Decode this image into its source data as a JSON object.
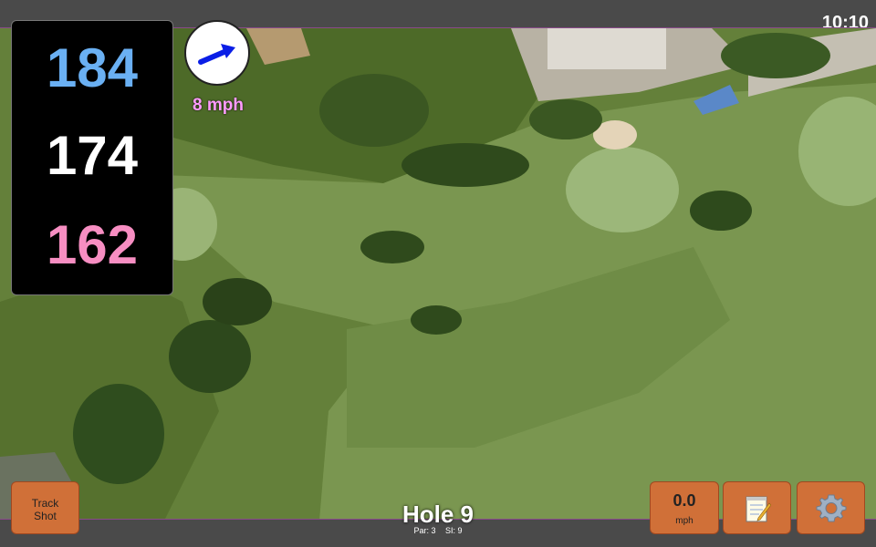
{
  "status": {
    "time": "10:10"
  },
  "distances": {
    "back": "184",
    "middle": "174",
    "front": "162"
  },
  "wind": {
    "speed": "8 mph",
    "direction_icon": "wind-arrow-icon"
  },
  "hole": {
    "title": "Hole 9",
    "par": "Par: 3",
    "si": "SI: 9"
  },
  "buttons": {
    "track_shot_line1": "Track",
    "track_shot_line2": "Shot",
    "speed_value": "0.0",
    "speed_unit": "mph",
    "notes_icon": "notepad-icon",
    "settings_icon": "gear-icon"
  },
  "colors": {
    "back": "#6ab0f3",
    "middle": "#ffffff",
    "front": "#f78ec2",
    "button": "#d07038",
    "wind_text": "#ff9bff"
  }
}
